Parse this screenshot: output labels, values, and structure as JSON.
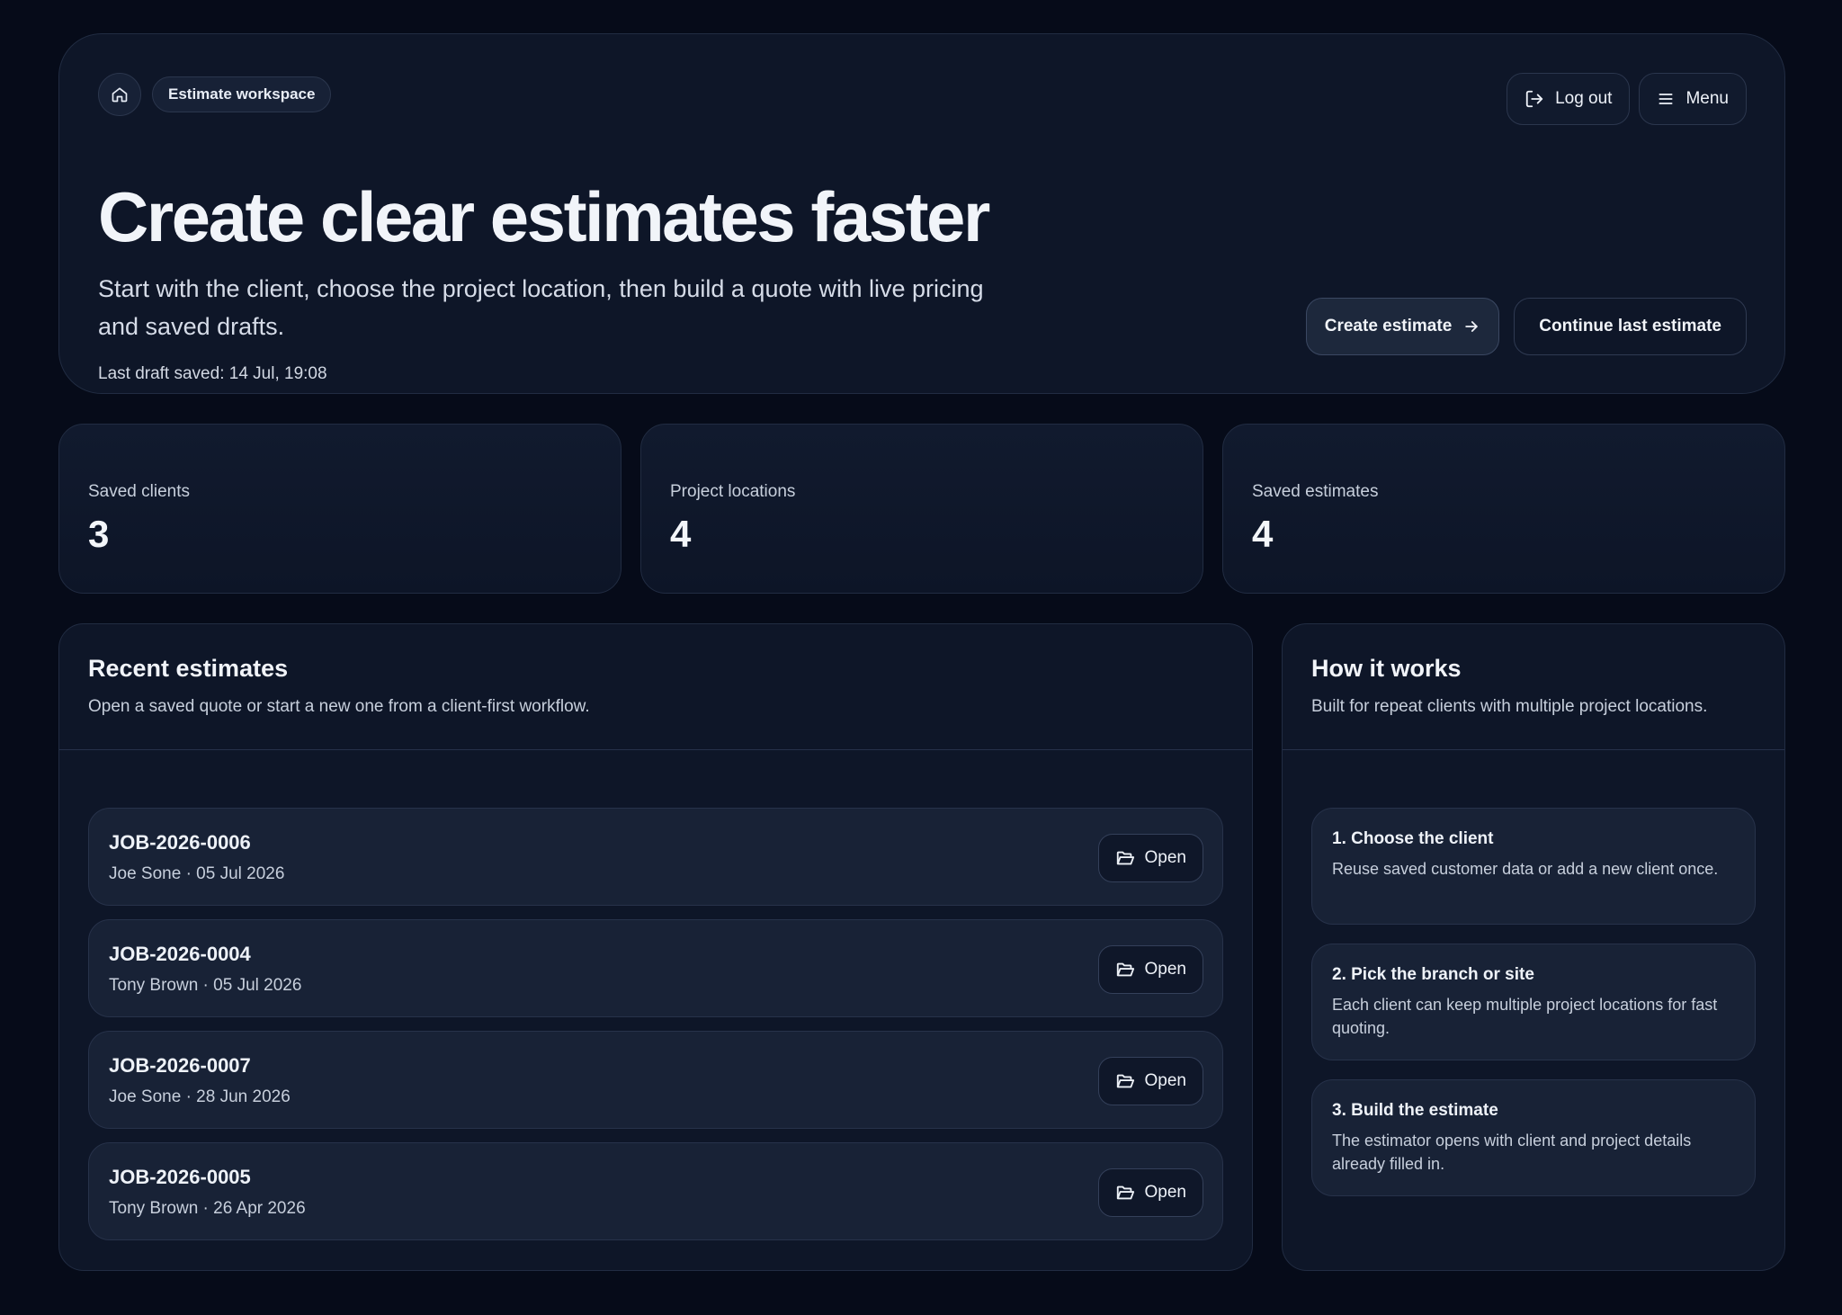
{
  "header": {
    "workspace_label": "Estimate workspace",
    "logout_label": "Log out",
    "menu_label": "Menu"
  },
  "hero": {
    "title": "Create clear estimates faster",
    "subtitle": "Start with the client, choose the project location, then build a quote with live pricing and saved drafts.",
    "last_saved": "Last draft saved: 14 Jul, 19:08",
    "create_label": "Create estimate",
    "continue_label": "Continue last estimate"
  },
  "stats": [
    {
      "label": "Saved clients",
      "value": "3"
    },
    {
      "label": "Project locations",
      "value": "4"
    },
    {
      "label": "Saved estimates",
      "value": "4"
    }
  ],
  "recent": {
    "title": "Recent estimates",
    "description": "Open a saved quote or start a new one from a client-first workflow.",
    "open_label": "Open",
    "items": [
      {
        "id": "JOB-2026-0006",
        "meta": "Joe Sone · 05 Jul 2026"
      },
      {
        "id": "JOB-2026-0004",
        "meta": "Tony Brown · 05 Jul 2026"
      },
      {
        "id": "JOB-2026-0007",
        "meta": "Joe Sone · 28 Jun 2026"
      },
      {
        "id": "JOB-2026-0005",
        "meta": "Tony Brown · 26 Apr 2026"
      }
    ]
  },
  "how": {
    "title": "How it works",
    "description": "Built for repeat clients with multiple project locations.",
    "steps": [
      {
        "title": "1. Choose the client",
        "body": "Reuse saved customer data or add a new client once."
      },
      {
        "title": "2. Pick the branch or site",
        "body": "Each client can keep multiple project locations for fast quoting."
      },
      {
        "title": "3. Build the estimate",
        "body": "The estimator opens with client and project details already filled in."
      }
    ]
  },
  "icons": {
    "home": "home-icon",
    "logout": "logout-icon",
    "menu": "hamburger-icon",
    "arrow": "arrow-right-icon",
    "folder": "folder-open-icon"
  },
  "colors": {
    "background": "#060b19",
    "card": "#0e1628",
    "row": "#182236",
    "border": "#212c42",
    "text": "#e8edf6",
    "muted": "#c7cfdc"
  }
}
